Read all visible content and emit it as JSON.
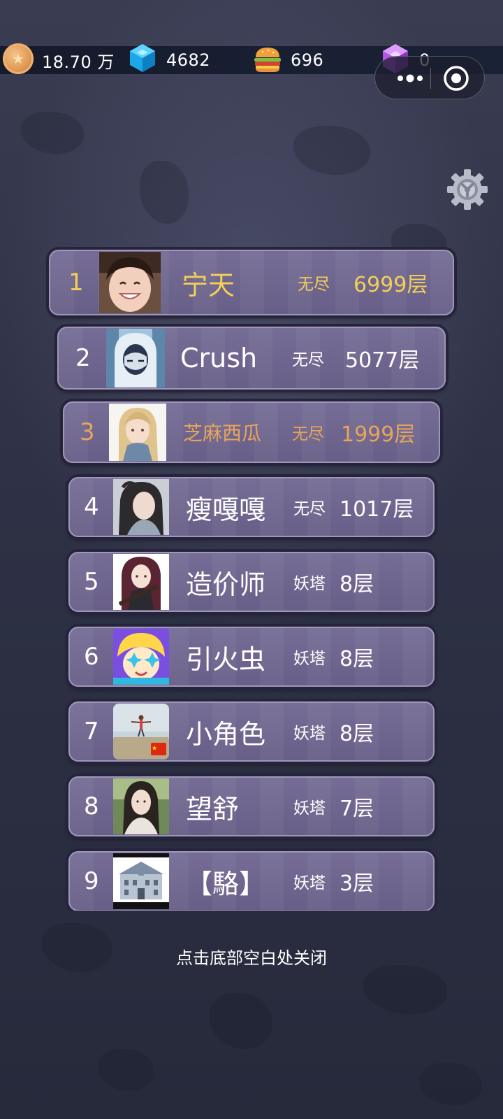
{
  "resources": {
    "coins": "18.70 万",
    "diamonds": "4682",
    "burgers": "696",
    "purple_gems": "0"
  },
  "leaderboard": [
    {
      "rank": "1",
      "name": "宁天",
      "mode": "无尽",
      "floor": "6999层"
    },
    {
      "rank": "2",
      "name": "Crush",
      "mode": "无尽",
      "floor": "5077层"
    },
    {
      "rank": "3",
      "name": "芝麻西瓜",
      "mode": "无尽",
      "floor": "1999层"
    },
    {
      "rank": "4",
      "name": "瘦嘎嘎",
      "mode": "无尽",
      "floor": "1017层"
    },
    {
      "rank": "5",
      "name": "造价师",
      "mode": "妖塔",
      "floor": "8层"
    },
    {
      "rank": "6",
      "name": "引火虫",
      "mode": "妖塔",
      "floor": "8层"
    },
    {
      "rank": "7",
      "name": "小角色",
      "mode": "妖塔",
      "floor": "8层"
    },
    {
      "rank": "8",
      "name": "望舒",
      "mode": "妖塔",
      "floor": "7层"
    },
    {
      "rank": "9",
      "name": "【駱】",
      "mode": "妖塔",
      "floor": "3层"
    }
  ],
  "close_hint": "点击底部空白处关闭",
  "icons": {
    "coin": "coin-icon",
    "diamond": "blue-diamond-icon",
    "burger": "burger-icon",
    "purple_gem": "purple-gem-icon",
    "more": "more-dots-icon",
    "close": "close-miniprogram-icon",
    "settings": "gear-icon"
  },
  "colors": {
    "rank1": "#f4cf58",
    "rank3": "#e8a45a",
    "row_bg": "#6e668f",
    "text": "#ffffff"
  }
}
